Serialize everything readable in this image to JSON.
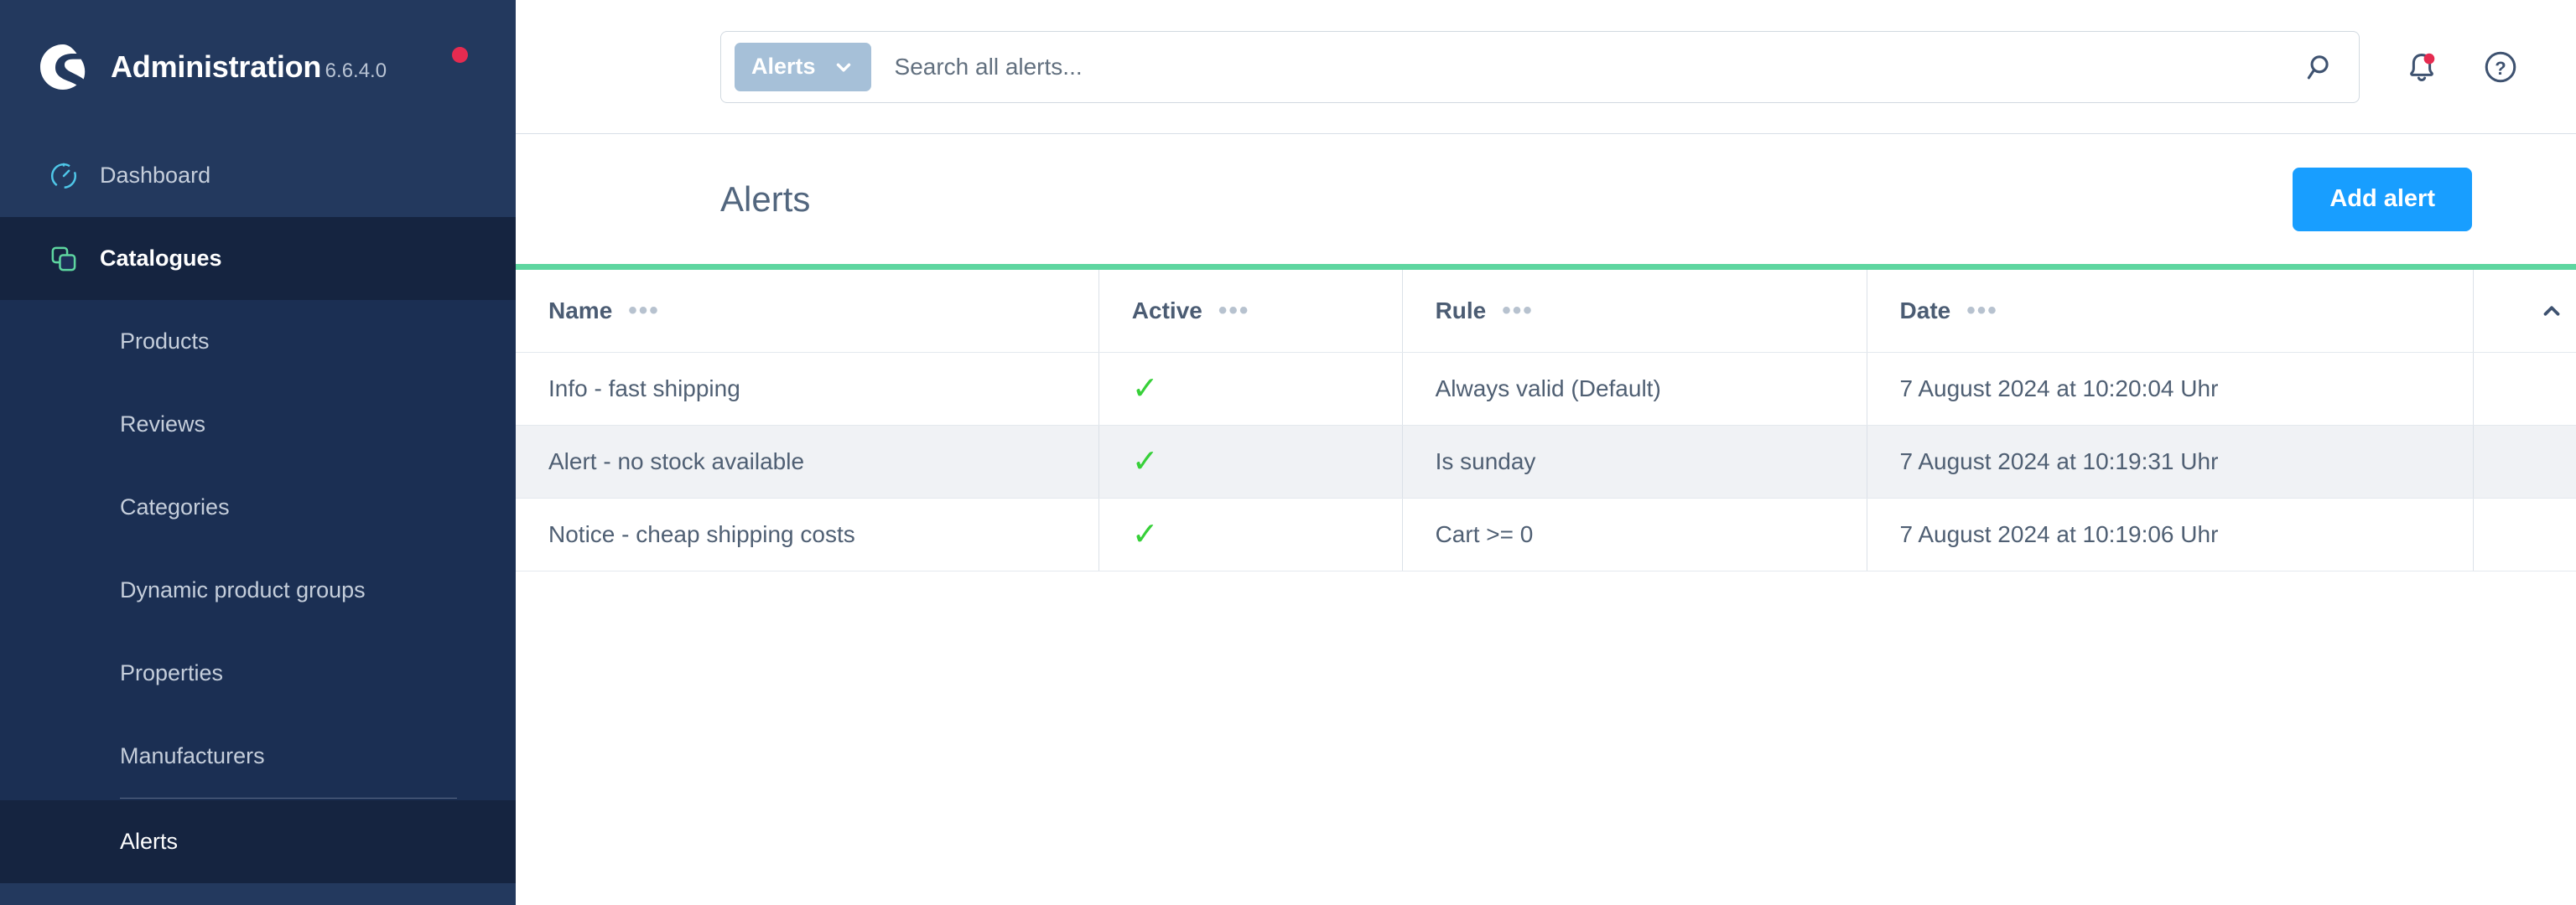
{
  "sidebar": {
    "brand": {
      "title": "Administration",
      "version": "6.6.4.0",
      "logo_icon": "shopware-logo-icon",
      "status_dot_color": "#e52b50"
    },
    "items": [
      {
        "label": "Dashboard",
        "icon": "gauge-icon",
        "icon_color": "#4fc7e8",
        "type": "top",
        "state": "default"
      },
      {
        "label": "Catalogues",
        "icon": "copy-squares-icon",
        "icon_color": "#5ed6a0",
        "type": "top",
        "state": "expanded"
      },
      {
        "label": "Products",
        "type": "sub",
        "state": "default"
      },
      {
        "label": "Reviews",
        "type": "sub",
        "state": "default"
      },
      {
        "label": "Categories",
        "type": "sub",
        "state": "default"
      },
      {
        "label": "Dynamic product groups",
        "type": "sub",
        "state": "default"
      },
      {
        "label": "Properties",
        "type": "sub",
        "state": "default"
      },
      {
        "label": "Manufacturers",
        "type": "sub",
        "state": "default"
      },
      {
        "label": "Alerts",
        "type": "sub",
        "state": "selected"
      }
    ]
  },
  "topbar": {
    "search_scope_label": "Alerts",
    "search_scope_chevron": "chevron-down-icon",
    "search_placeholder": "Search all alerts...",
    "search_value": "",
    "search_icon": "search-icon",
    "notifications_icon": "bell-icon",
    "notifications_badge": true,
    "notifications_badge_color": "#e52b50",
    "help_icon": "question-circle-icon"
  },
  "page": {
    "title": "Alerts",
    "add_button_label": "Add alert",
    "add_button_color": "#189eff",
    "accent_line_color": "#5ed6a0"
  },
  "table": {
    "columns": [
      {
        "key": "name",
        "label": "Name",
        "menu_icon": "ellipsis-icon"
      },
      {
        "key": "active",
        "label": "Active",
        "menu_icon": "ellipsis-icon"
      },
      {
        "key": "rule",
        "label": "Rule",
        "menu_icon": "ellipsis-icon"
      },
      {
        "key": "date",
        "label": "Date",
        "menu_icon": "ellipsis-icon"
      }
    ],
    "sort": {
      "column": "date",
      "direction": "asc",
      "icon": "chevron-up-icon"
    },
    "refresh_icon": "refresh-counterclockwise-icon",
    "row_actions_icon": "ellipsis-icon",
    "active_check_icon": "check-icon",
    "active_check_color": "#37d039",
    "rows": [
      {
        "name": "Info - fast shipping",
        "active": true,
        "rule": "Always valid (Default)",
        "date": "7 August 2024 at 10:20:04 Uhr",
        "highlighted": false
      },
      {
        "name": "Alert - no stock available",
        "active": true,
        "rule": "Is sunday",
        "date": "7 August 2024 at 10:19:31 Uhr",
        "highlighted": true
      },
      {
        "name": "Notice - cheap shipping costs",
        "active": true,
        "rule": "Cart >= 0",
        "date": "7 August 2024 at 10:19:06 Uhr",
        "highlighted": false
      }
    ]
  }
}
